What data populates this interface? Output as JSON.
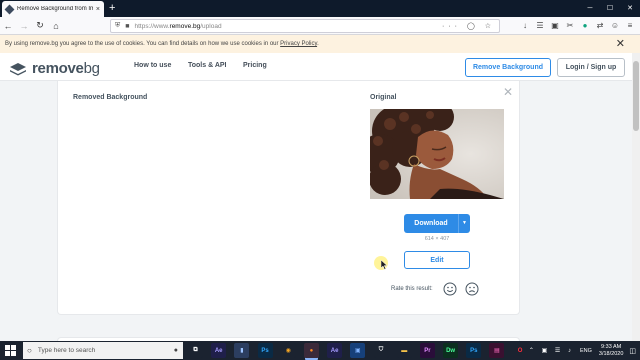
{
  "browser": {
    "tab_title": "Remove Background from Ima",
    "tab_close": "×",
    "new_tab": "+",
    "url_prefix": "https://www.",
    "url_domain": "remove.bg",
    "url_path": "/upload",
    "window_controls": [
      "─",
      "☐",
      "✕"
    ]
  },
  "cookie": {
    "text_before": "By using remove.bg you agree to the use of cookies. You can find details on how we use cookies in our ",
    "link": "Privacy Policy",
    "text_after": ".",
    "close": "✕"
  },
  "header": {
    "logo_part1": "remove",
    "logo_part2": "bg",
    "nav": [
      "How to use",
      "Tools & API",
      "Pricing"
    ],
    "remove_bg_button": "Remove Background",
    "login_button": "Login / Sign up"
  },
  "result": {
    "removed_label": "Removed Background",
    "original_label": "Original",
    "close": "✕",
    "download_label": "Download",
    "dimensions": "614 × 407",
    "edit_label": "Edit",
    "rate_label": "Rate this result:"
  },
  "taskbar": {
    "search_placeholder": "Type here to search",
    "apps": [
      {
        "name": "task-view",
        "glyph": "⧉",
        "bg": "#1b2330",
        "fg": "#ffffff"
      },
      {
        "name": "after-effects",
        "glyph": "Ae",
        "bg": "#1f1f4a",
        "fg": "#a59bff"
      },
      {
        "name": "file",
        "glyph": "▮",
        "bg": "#2c3e60",
        "fg": "#9cc3ff"
      },
      {
        "name": "photoshop",
        "glyph": "Ps",
        "bg": "#0a2a45",
        "fg": "#31a8ff"
      },
      {
        "name": "blender",
        "glyph": "◉",
        "bg": "#1b2330",
        "fg": "#f5a623"
      },
      {
        "name": "firefox",
        "glyph": "●",
        "bg": "#3b2a3a",
        "fg": "#ff8a1f"
      },
      {
        "name": "after-effects-2",
        "glyph": "Ae",
        "bg": "#1f1f4a",
        "fg": "#a59bff"
      },
      {
        "name": "app-blue",
        "glyph": "▣",
        "bg": "#16407a",
        "fg": "#7fb3ff"
      },
      {
        "name": "store",
        "glyph": "⛉",
        "bg": "#1b2330",
        "fg": "#ffffff"
      },
      {
        "name": "folder",
        "glyph": "▬",
        "bg": "#1b2330",
        "fg": "#f6c24a"
      },
      {
        "name": "premiere",
        "glyph": "Pr",
        "bg": "#2a0d3a",
        "fg": "#e28bff"
      },
      {
        "name": "dreamweaver",
        "glyph": "Dw",
        "bg": "#0c2f1f",
        "fg": "#4aff9a"
      },
      {
        "name": "photoshop-2",
        "glyph": "Ps",
        "bg": "#0a2a45",
        "fg": "#31a8ff"
      },
      {
        "name": "app-pink",
        "glyph": "▤",
        "bg": "#3a1030",
        "fg": "#ff6fc1"
      },
      {
        "name": "opera",
        "glyph": "O",
        "bg": "#1b2330",
        "fg": "#ff2d3b"
      }
    ],
    "lang": "ENG",
    "time": "9:33 AM",
    "date": "3/18/2020"
  },
  "colors": {
    "accent": "#2e8be6",
    "text": "#45535f",
    "cookie_bg": "#fdf2e0"
  }
}
